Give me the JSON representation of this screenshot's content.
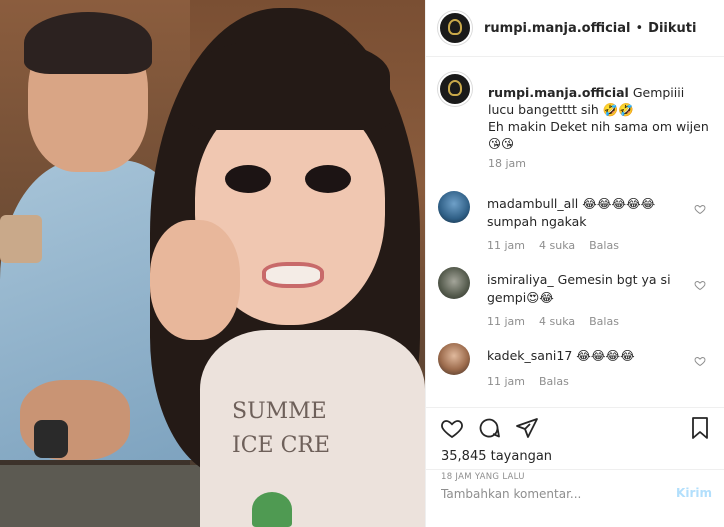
{
  "header": {
    "username": "rumpi.manja.official",
    "separator": "•",
    "follow_status": "Diikuti"
  },
  "caption": {
    "username": "rumpi.manja.official",
    "text_line1": " Gempiiii lucu bangetttt sih 🤣🤣",
    "text_line2": "Eh makin Deket nih sama om wijen 😘😘",
    "time": "18 jam"
  },
  "comments": [
    {
      "username": "madambull_all",
      "text": " 😂😂😂😂😂",
      "text2": "sumpah ngakak",
      "time": "11 jam",
      "likes": "4 suka",
      "reply": "Balas"
    },
    {
      "username": "ismiraliya_",
      "text": " Gemesin bgt ya si gempi😍😂",
      "text2": "",
      "time": "11 jam",
      "likes": "4 suka",
      "reply": "Balas"
    },
    {
      "username": "kadek_sani17",
      "text": " 😂😂😂😂",
      "text2": "",
      "time": "11 jam",
      "likes": "",
      "reply": "Balas"
    }
  ],
  "stats": {
    "views": "35,845 tayangan",
    "posted_ago": "18 JAM YANG LALU"
  },
  "input": {
    "placeholder": "Tambahkan komentar...",
    "send_label": "Kirim"
  },
  "media": {
    "shirt_print_line1": "SUMME",
    "shirt_print_line2": "ICE CRE"
  },
  "colors": {
    "link_blue_disabled": "#b2dffc",
    "muted": "#8e8e8e",
    "text": "#262626",
    "border": "#efefef"
  },
  "icons": {
    "like": "heart-icon",
    "comment": "comment-icon",
    "share": "paper-plane-icon",
    "save": "bookmark-icon",
    "comment_like": "small-heart-icon"
  }
}
